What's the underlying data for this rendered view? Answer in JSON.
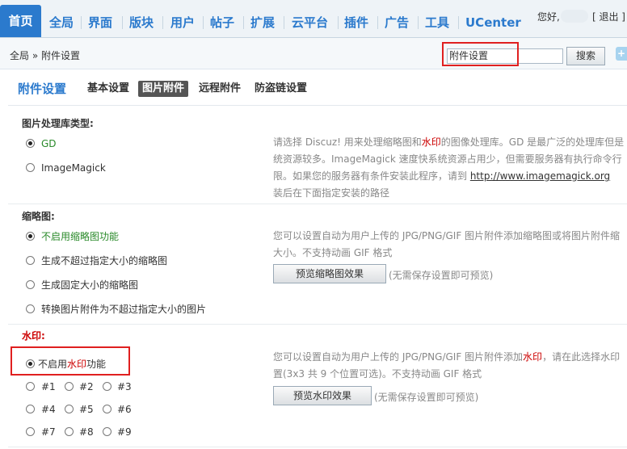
{
  "topnav": {
    "items": [
      "首页",
      "全局",
      "界面",
      "版块",
      "用户",
      "帖子",
      "扩展",
      "云平台",
      "插件",
      "广告",
      "工具",
      "UCenter"
    ],
    "greeting": "您好,",
    "logout": "[ 退出 ]"
  },
  "breadcrumb": "全局 » 附件设置",
  "search": {
    "value": "附件设置",
    "button": "搜索",
    "plus": "+"
  },
  "subnav": {
    "title": "附件设置",
    "tabs": [
      "基本设置",
      "图片附件",
      "远程附件",
      "防盗链设置"
    ]
  },
  "sections": {
    "lib": {
      "title": "图片处理库类型:",
      "options": [
        "GD",
        "ImageMagick"
      ],
      "desc1": "请选择 Discuz! 用来处理缩略图和",
      "desc_hl": "水印",
      "desc2": "的图像处理库。GD 是最广泛的处理库但是",
      "desc3": "统资源较多。ImageMagick 速度快系统资源占用少，但需要服务器有执行命令行",
      "desc4": "限。如果您的服务器有条件安装此程序，请到 ",
      "link": "http://www.imagemagick.org",
      "desc5": "装后在下面指定安装的路径"
    },
    "thumb": {
      "title": "缩略图:",
      "options": [
        "不启用缩略图功能",
        "生成不超过指定大小的缩略图",
        "生成固定大小的缩略图",
        "转换图片附件为不超过指定大小的图片"
      ],
      "desc1": "您可以设置自动为用户上传的 JPG/PNG/GIF 图片附件添加缩略图或将图片附件缩",
      "desc2": "大小。不支持动画 GIF 格式",
      "preview": "预览缩略图效果",
      "note": "(无需保存设置即可预览)"
    },
    "watermark": {
      "title": "水印:",
      "opt_pre": "不启用",
      "opt_hl": "水印",
      "opt_post": "功能",
      "positions": [
        "#1",
        "#2",
        "#3",
        "#4",
        "#5",
        "#6",
        "#7",
        "#8",
        "#9"
      ],
      "desc1": "您可以设置自动为用户上传的 JPG/PNG/GIF 图片附件添加",
      "desc_hl": "水印",
      "desc2": "，请在此选择水印",
      "desc3": "置(3x3 共 9 个位置可选)。不支持动画 GIF 格式",
      "preview": "预览水印效果",
      "note": "(无需保存设置即可预览)"
    }
  }
}
